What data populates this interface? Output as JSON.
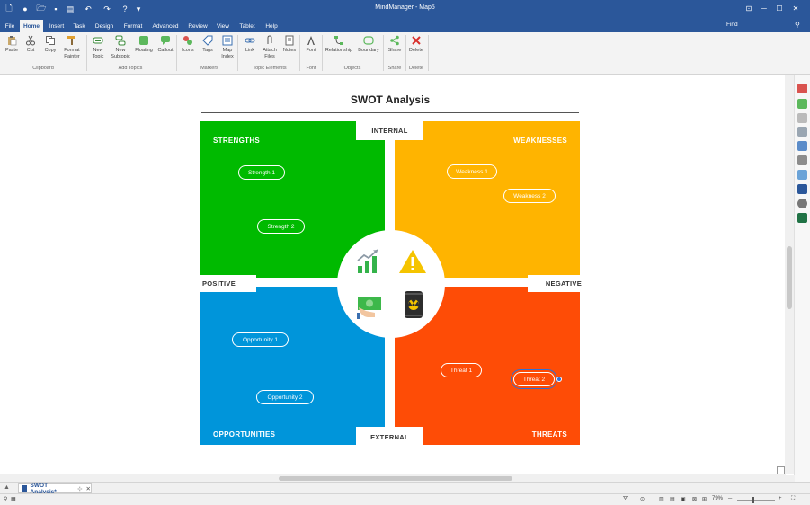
{
  "app": {
    "title": "MindManager - Map5"
  },
  "menu": {
    "tabs": [
      "File",
      "Home",
      "Insert",
      "Task",
      "Design",
      "Format",
      "Advanced",
      "Review",
      "View",
      "Tablet",
      "Help"
    ],
    "active": "Home",
    "find_label": "Find"
  },
  "ribbon": {
    "buttons": {
      "paste": "Paste",
      "cut": "Cut",
      "copy": "Copy",
      "format_painter": "Format Painter",
      "new_topic": "New Topic",
      "new_subtopic": "New Subtopic",
      "floating": "Floating",
      "callout": "Callout",
      "icons": "Icons",
      "tags": "Tags",
      "map_index": "Map Index",
      "link": "Link",
      "attach_files": "Attach Files",
      "notes": "Notes",
      "font": "Font",
      "relationship": "Relationship",
      "boundary": "Boundary",
      "share": "Share",
      "delete": "Delete"
    },
    "groups": {
      "clipboard": "Clipboard",
      "add_topics": "Add Topics",
      "markers": "Markers",
      "topic_elements": "Topic Elements",
      "font": "Font",
      "objects": "Objects",
      "share": "Share",
      "delete": "Delete"
    }
  },
  "swot": {
    "title": "SWOT Analysis",
    "quadrants": {
      "strengths": {
        "title": "STRENGTHS",
        "color": "#00ba00",
        "items": [
          "Strength 1",
          "Strength 2"
        ]
      },
      "weaknesses": {
        "title": "WEAKNESSES",
        "color": "#ffb400",
        "items": [
          "Weakness 1",
          "Weakness 2"
        ]
      },
      "opportunities": {
        "title": "OPPORTUNITIES",
        "color": "#0095da",
        "items": [
          "Opportunity 1",
          "Opportunity 2"
        ]
      },
      "threats": {
        "title": "THREATS",
        "color": "#fe4c06",
        "items": [
          "Threat 1",
          "Threat 2"
        ]
      }
    },
    "axes": {
      "top": "INTERNAL",
      "bottom": "EXTERNAL",
      "left": "POSITIVE",
      "right": "NEGATIVE"
    },
    "selected_item": "Threat 2"
  },
  "document": {
    "tab_label": "SWOT Analysis*"
  },
  "status": {
    "zoom": "79%"
  },
  "colors": {
    "accent": "#2b579a"
  }
}
